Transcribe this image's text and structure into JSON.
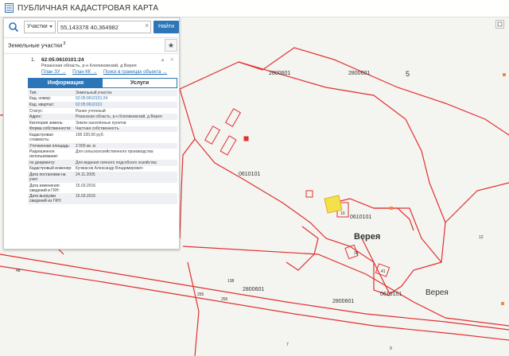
{
  "header": {
    "title": "ПУБЛИЧНАЯ КАДАСТРОВАЯ КАРТА"
  },
  "search": {
    "type_selected": "Участки",
    "query": "55,143378 40,364982",
    "clear_label": "×",
    "find_label": "Найти"
  },
  "results_section": {
    "title": "Земельные участки",
    "count": "3",
    "star_label": "★"
  },
  "result": {
    "number": "1.",
    "cadastral_number": "62:05:0610101:24",
    "address": "Рязанская область, р-н Клепиковский, д Верея",
    "actions": "▲ ✕",
    "links": [
      "План ЗУ →",
      "План КК →",
      "Поиск в границах объекта →"
    ],
    "tabs": [
      "Информация",
      "Услуги"
    ],
    "fields": [
      {
        "label": "Тип:",
        "value": "Земельный участок"
      },
      {
        "label": "Кад. номер:",
        "value": "62:05:0610101:24"
      },
      {
        "label": "Кад. квартал:",
        "value": "62:05:0610101"
      },
      {
        "label": "Статус:",
        "value": "Ранее учтенный"
      },
      {
        "label": "Адрес:",
        "value": "Рязанская область, р-н Клепиковский, д Верея"
      },
      {
        "label": "Категория земель:",
        "value": "Земли населённых пунктов"
      },
      {
        "label": "Форма собственности:",
        "value": "Частная собственность"
      },
      {
        "label": "Кадастровая стоимость:",
        "value": "195 220,00 руб."
      },
      {
        "label": "Уточненная площадь:",
        "value": "2 000 кв. м"
      },
      {
        "label": "Разрешенное использование:",
        "value": "Для сельскохозяйственного производства"
      },
      {
        "label": "по документу:",
        "value": "Для ведения личного подсобного хозяйства"
      },
      {
        "label": "Кадастровый инженер:",
        "value": "Кучмасов Александр Владимирович"
      },
      {
        "label": "Дата постановки на учет:",
        "value": "24.11.2005"
      },
      {
        "label": "Дата изменения сведений в ГКН:",
        "value": "15.03.2016"
      },
      {
        "label": "Дата выгрузки сведений из ГКН:",
        "value": "16.03.2016"
      }
    ]
  },
  "map": {
    "labels": {
      "quarter_top_left": "2800601",
      "quarter_top_right": "2800601",
      "district_5": "5",
      "district_5_left": "5",
      "quarter_0610101_left": "0610101",
      "quarter_0610101_right": "0610101",
      "quarter_0610101_bottom": "0610101",
      "village_main": "Верея",
      "village_secondary": "Верея",
      "quarter_bottom_center": "2800601",
      "quarter_bottom_right": "2800601",
      "road_138": "138",
      "road_255": "255",
      "road_256": "256",
      "plot_10": "10",
      "plot_41": "41",
      "plot_28": "28",
      "plot_48": "48",
      "plot_7": "7",
      "plot_9": "9",
      "plot_12": "12"
    },
    "colors": {
      "boundary": "#e03030",
      "selected_fill": "#f4e04a",
      "background": "#f4f4f1"
    }
  }
}
